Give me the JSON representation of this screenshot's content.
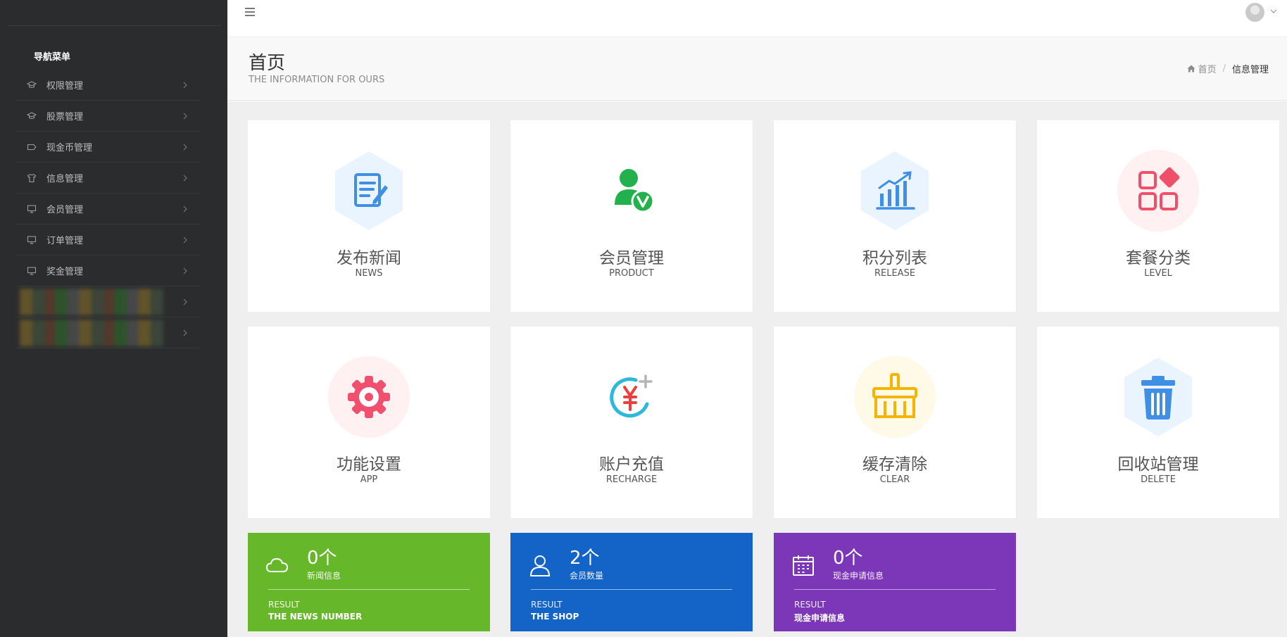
{
  "sidebar": {
    "header": "导航菜单",
    "items": [
      {
        "label": "权限管理"
      },
      {
        "label": "股票管理"
      },
      {
        "label": "现金币管理"
      },
      {
        "label": "信息管理"
      },
      {
        "label": "会员管理"
      },
      {
        "label": "订单管理"
      },
      {
        "label": "奖金管理"
      }
    ]
  },
  "page": {
    "title": "首页",
    "subtitle": "THE INFORMATION FOR OURS"
  },
  "breadcrumb": {
    "home": "首页",
    "separator": "/",
    "current": "信息管理"
  },
  "cards": [
    {
      "title": "发布新闻",
      "subtitle": "NEWS",
      "icon": "news-edit-icon"
    },
    {
      "title": "会员管理",
      "subtitle": "PRODUCT",
      "icon": "member-verified-icon"
    },
    {
      "title": "积分列表",
      "subtitle": "RELEASE",
      "icon": "bar-chart-icon"
    },
    {
      "title": "套餐分类",
      "subtitle": "LEVEL",
      "icon": "category-grid-icon"
    },
    {
      "title": "功能设置",
      "subtitle": "APP",
      "icon": "gear-icon"
    },
    {
      "title": "账户充值",
      "subtitle": "RECHARGE",
      "icon": "yuan-recharge-icon"
    },
    {
      "title": "缓存清除",
      "subtitle": "CLEAR",
      "icon": "broom-icon"
    },
    {
      "title": "回收站管理",
      "subtitle": "DELETE",
      "icon": "trash-icon"
    }
  ],
  "stats": [
    {
      "value": "0个",
      "label": "新闻信息",
      "result": "RESULT",
      "desc": "THE NEWS NUMBER",
      "color": "#66b82a",
      "icon": "cloud-icon"
    },
    {
      "value": "2个",
      "label": "会员数量",
      "result": "RESULT",
      "desc": "THE SHOP",
      "color": "#1464c8",
      "icon": "user-icon"
    },
    {
      "value": "0个",
      "label": "现金申请信息",
      "result": "RESULT",
      "desc": "现金申请信息",
      "color": "#7b37b8",
      "icon": "calendar-icon"
    }
  ],
  "colors": {
    "sidebar_bg": "#2b2c2e",
    "content_bg": "#efefef",
    "blue_icon": "#3f8fe5",
    "green_icon": "#22b14c",
    "pink_icon": "#f04f6a",
    "red_icon": "#f0506e",
    "yellow_icon": "#f5b400",
    "teal_icon": "#2db8e0"
  }
}
